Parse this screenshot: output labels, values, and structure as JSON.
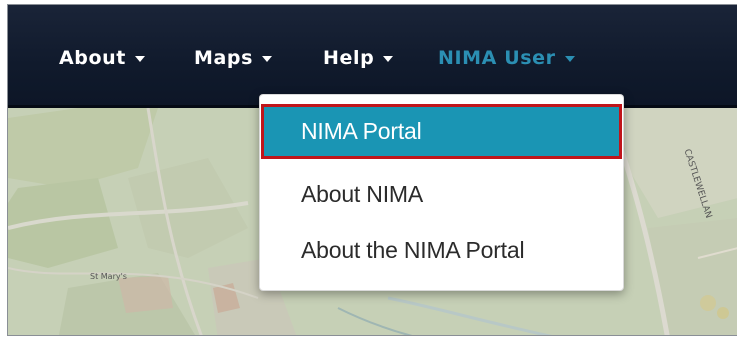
{
  "navbar": {
    "items": [
      {
        "label": "About"
      },
      {
        "label": "Maps"
      },
      {
        "label": "Help"
      },
      {
        "label": "NIMA User"
      }
    ]
  },
  "dropdown": {
    "items": [
      {
        "label": "NIMA Portal",
        "highlighted": true
      },
      {
        "label": "About NIMA"
      },
      {
        "label": "About the NIMA Portal"
      }
    ]
  },
  "map": {
    "labels": [
      "St Mary's",
      "CASTLEWELLAN"
    ]
  },
  "colors": {
    "navbar_bg": "#101a2c",
    "nav_text": "#ffffff",
    "nav_active": "#2b8fb3",
    "highlight_bg": "#1a95b4",
    "highlight_border": "#c0151b"
  }
}
